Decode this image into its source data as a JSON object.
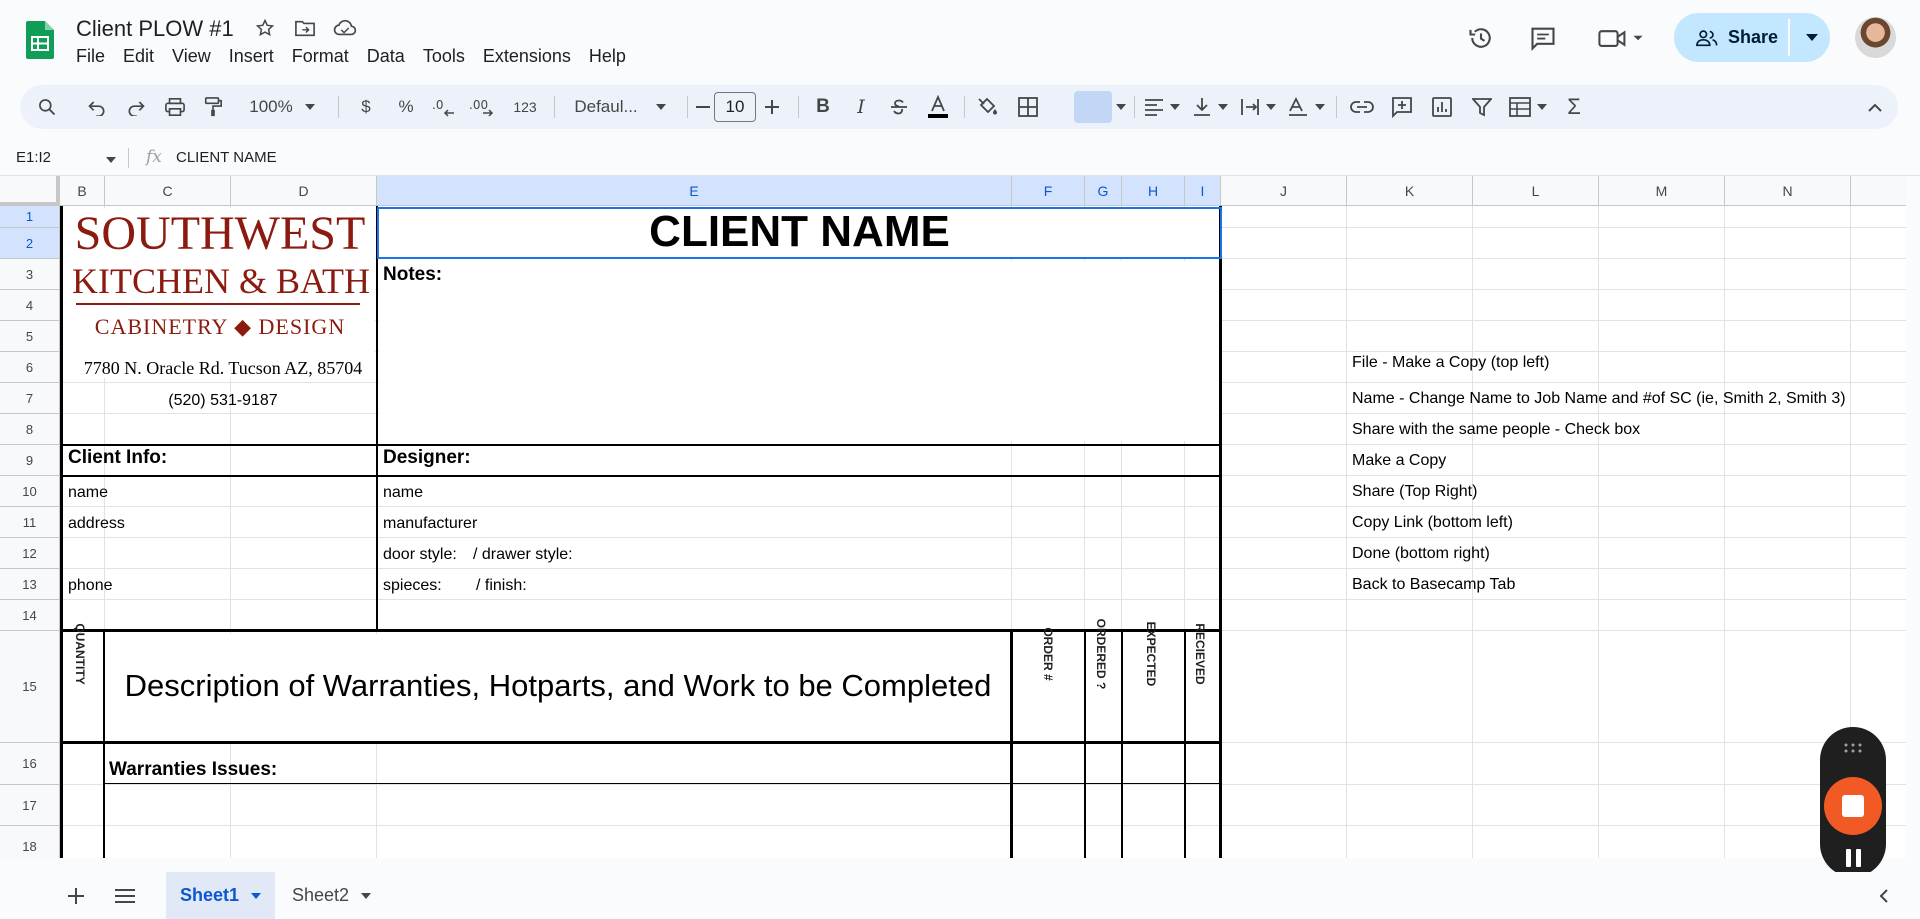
{
  "app": {
    "doc_title": "Client PLOW #1",
    "menu": [
      "File",
      "Edit",
      "View",
      "Insert",
      "Format",
      "Data",
      "Tools",
      "Extensions",
      "Help"
    ],
    "share_label": "Share"
  },
  "toolbar": {
    "zoom": "100%",
    "currency": "$",
    "percent": "%",
    "number_format": "123",
    "font_name": "Defaul...",
    "font_size": "10"
  },
  "formula_bar": {
    "name_box": "E1:I2",
    "fx": "fx",
    "value": "CLIENT NAME"
  },
  "grid": {
    "columns": [
      "B",
      "C",
      "D",
      "E",
      "F",
      "G",
      "H",
      "I",
      "J",
      "K",
      "L",
      "M",
      "N"
    ],
    "selected_columns": [
      "E",
      "F",
      "G",
      "H",
      "I"
    ],
    "rows": [
      "1",
      "2",
      "3",
      "4",
      "5",
      "6",
      "7",
      "8",
      "9",
      "10",
      "11",
      "12",
      "13",
      "14",
      "15",
      "16",
      "17",
      "18"
    ],
    "selected_rows": [
      "1",
      "2"
    ]
  },
  "sheet": {
    "client_name": "CLIENT NAME",
    "notes_label": "Notes:",
    "brand_line1": "SOUTHWEST",
    "brand_line2": "KITCHEN & BATH",
    "brand_line3": "CABINETRY ◆ DESIGN",
    "address": "7780 N. Oracle Rd. Tucson AZ, 85704",
    "phone_number": "(520) 531-9187",
    "client_info_label": "Client Info:",
    "designer_label": "Designer:",
    "client_fields": [
      "name",
      "address",
      "phone"
    ],
    "designer_fields": {
      "name": "name",
      "manufacturer": "manufacturer",
      "door_style": "door style:",
      "drawer_style": "/ drawer style:",
      "species": "spieces:",
      "finish": "/ finish:"
    },
    "quantity_header": "QUANTITY",
    "description_header": "Description of Warranties, Hotparts, and Work to be Completed",
    "order_header": "ORDER #",
    "ordered_header": "ORDERED ?",
    "expected_header": "EXPECTED",
    "received_header": "RECIEVED",
    "warranties_label": "Warranties Issues:",
    "instructions": [
      "File - Make a Copy (top left)",
      "Name - Change Name to Job Name and #of SC (ie, Smith 2, Smith 3)",
      "Share with the same people - Check box",
      "Make a Copy",
      "Share (Top Right)",
      "Copy Link (bottom left)",
      "Done (bottom right)",
      "Back to Basecamp Tab"
    ]
  },
  "tabs": [
    {
      "label": "Sheet1",
      "active": true
    },
    {
      "label": "Sheet2",
      "active": false
    }
  ],
  "colors": {
    "accent": "#0b57d0",
    "share_bg": "#c2e7ff",
    "brand": "#8b1a0f",
    "selection": "#1a73e8",
    "recorder_stop": "#f15a24"
  },
  "icons": {
    "logo": "sheets-logo-icon",
    "star": "star-icon",
    "move": "move-folder-icon",
    "cloud": "cloud-status-icon",
    "history": "history-icon",
    "comment": "comment-icon",
    "meet": "video-call-icon",
    "share": "people-icon"
  }
}
